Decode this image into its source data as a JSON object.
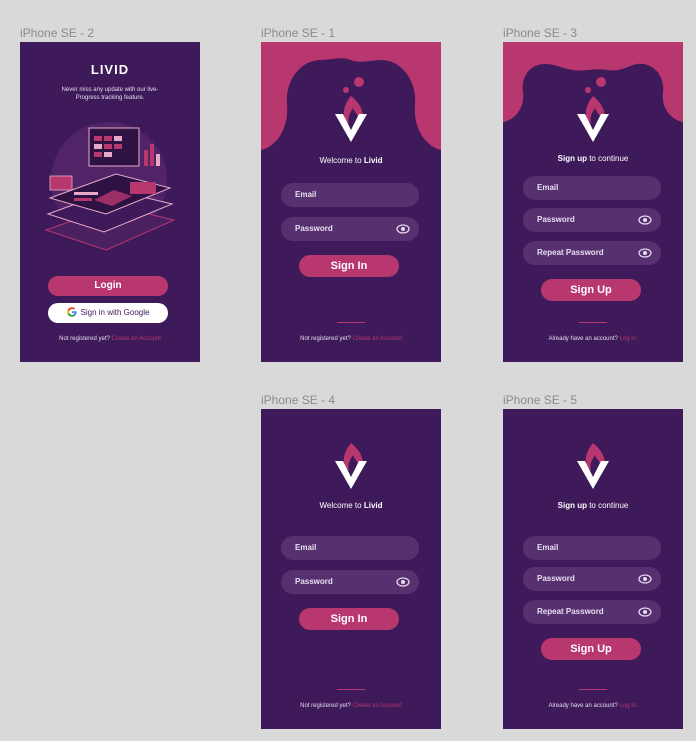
{
  "colors": {
    "canvas": "#d9d9d9",
    "frame_bg": "#3f1a5a",
    "accent": "#b8376f",
    "field_bg": "#56306f",
    "text_light": "#ffffff"
  },
  "frames": {
    "landing": {
      "label": "iPhone SE - 2",
      "brand": "LIVID",
      "tagline": "Never miss any update with our live-Progress tracking feature.",
      "login_label": "Login",
      "google_label": "Sign in with Google",
      "footer_text": "Not registered yet?",
      "footer_link": "Create an Account"
    },
    "signin_1": {
      "label": "iPhone SE - 1",
      "welcome_prefix": "Welcome to",
      "welcome_bold": "Livid",
      "email_placeholder": "Email",
      "password_placeholder": "Password",
      "button_label": "Sign In",
      "footer_text": "Not registered yet?",
      "footer_link": "Create an Account"
    },
    "signup_3": {
      "label": "iPhone SE - 3",
      "welcome_bold": "Sign up",
      "welcome_suffix": "to continue",
      "email_placeholder": "Email",
      "password_placeholder": "Password",
      "repeat_placeholder": "Repeat Password",
      "button_label": "Sign Up",
      "footer_text": "Already have an account?",
      "footer_link": "Log in."
    },
    "signin_4": {
      "label": "iPhone SE - 4",
      "welcome_prefix": "Welcome to",
      "welcome_bold": "Livid",
      "email_placeholder": "Email",
      "password_placeholder": "Password",
      "button_label": "Sign In",
      "footer_text": "Not registered yet?",
      "footer_link": "Create an Account"
    },
    "signup_5": {
      "label": "iPhone SE - 5",
      "welcome_bold": "Sign up",
      "welcome_suffix": "to continue",
      "email_placeholder": "Email",
      "password_placeholder": "Password",
      "repeat_placeholder": "Repeat Password",
      "button_label": "Sign Up",
      "footer_text": "Already have an account?",
      "footer_link": "Log in."
    }
  }
}
